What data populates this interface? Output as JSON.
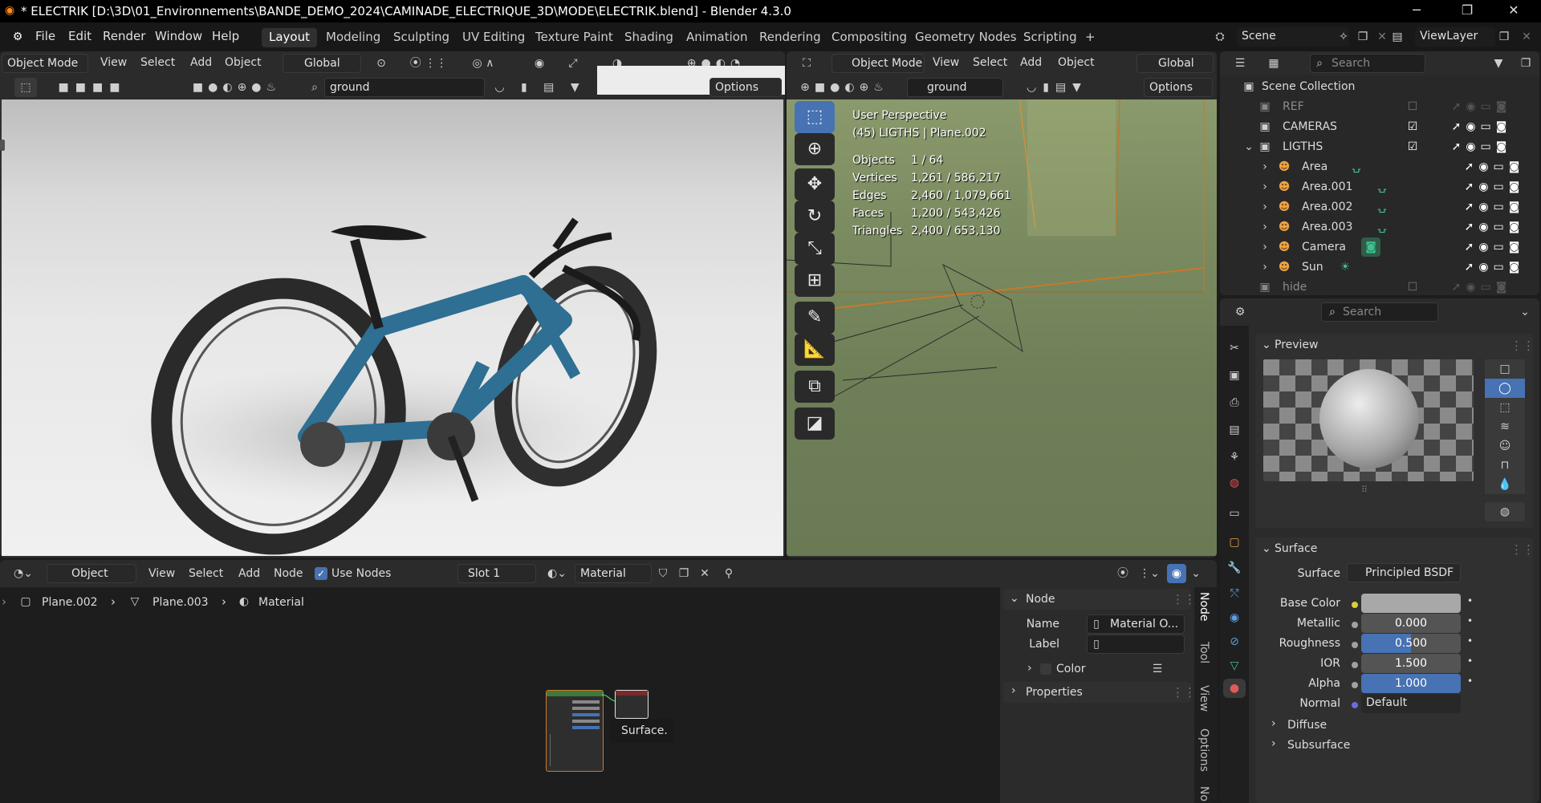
{
  "window": {
    "title": "* ELECTRIK [D:\\3D\\01_Environnements\\BANDE_DEMO_2024\\CAMINADE_ELECTRIQUE_3D\\MODE\\ELECTRIK.blend] - Blender 4.3.0",
    "min": "─",
    "max": "❐",
    "close": "✕"
  },
  "menu": {
    "file": "File",
    "edit": "Edit",
    "render": "Render",
    "window": "Window",
    "help": "Help"
  },
  "workspaces": [
    "Layout",
    "Modeling",
    "Sculpting",
    "UV Editing",
    "Texture Paint",
    "Shading",
    "Animation",
    "Rendering",
    "Compositing",
    "Geometry Nodes",
    "Scripting",
    "+"
  ],
  "scene": {
    "scene_name": "Scene",
    "view_layer": "ViewLayer"
  },
  "viewport_left": {
    "mode": "Object Mode",
    "view": "View",
    "select": "Select",
    "add": "Add",
    "object": "Object",
    "orientation": "Global",
    "search": "ground",
    "options": "Options"
  },
  "viewport_right": {
    "mode": "Object Mode",
    "view": "View",
    "select": "Select",
    "add": "Add",
    "object": "Object",
    "orientation": "Global",
    "search": "ground",
    "options": "Options",
    "perspective": "User Perspective",
    "context": "(45) LIGTHS | Plane.002",
    "stats": [
      {
        "label": "Objects",
        "value": "1 / 64"
      },
      {
        "label": "Vertices",
        "value": "1,261 / 586,217"
      },
      {
        "label": "Edges",
        "value": "2,460 / 1,079,661"
      },
      {
        "label": "Faces",
        "value": "1,200 / 543,426"
      },
      {
        "label": "Triangles",
        "value": "2,400 / 653,130"
      }
    ]
  },
  "outliner": {
    "search": "Search",
    "root": "Scene Collection",
    "collections": [
      {
        "name": "REF"
      },
      {
        "name": "CAMERAS"
      },
      {
        "name": "LIGTHS"
      }
    ],
    "children": [
      {
        "name": "Area"
      },
      {
        "name": "Area.001"
      },
      {
        "name": "Area.002"
      },
      {
        "name": "Area.003"
      },
      {
        "name": "Camera"
      },
      {
        "name": "Sun"
      }
    ],
    "hide": "hide"
  },
  "properties": {
    "search": "Search",
    "preview_label": "Preview",
    "surface_panel": "Surface",
    "surface_label": "Surface",
    "surface_value": "Principled BSDF",
    "rows": [
      {
        "label": "Base Color",
        "value": ""
      },
      {
        "label": "Metallic",
        "value": "0.000"
      },
      {
        "label": "Roughness",
        "value": "0.500"
      },
      {
        "label": "IOR",
        "value": "1.500"
      },
      {
        "label": "Alpha",
        "value": "1.000"
      },
      {
        "label": "Normal",
        "value": "Default"
      }
    ],
    "diffuse": "Diffuse",
    "subsurface": "Subsurface",
    "roughness_fraction": 0.5
  },
  "node_editor": {
    "editor_type": "Object",
    "view": "View",
    "select": "Select",
    "add": "Add",
    "node": "Node",
    "use_nodes": "Use Nodes",
    "slot": "Slot 1",
    "material": "Material",
    "breadcrumb": [
      "Plane.002",
      "Plane.003",
      "Material"
    ],
    "tooltip": "Surface."
  },
  "sidebar": {
    "node_panel": "Node",
    "name_label": "Name",
    "name_value": "Material O...",
    "label_label": "Label",
    "label_value": "",
    "color": "Color",
    "properties": "Properties",
    "tabs": [
      "Node",
      "Tool",
      "View",
      "Options",
      "No"
    ]
  }
}
